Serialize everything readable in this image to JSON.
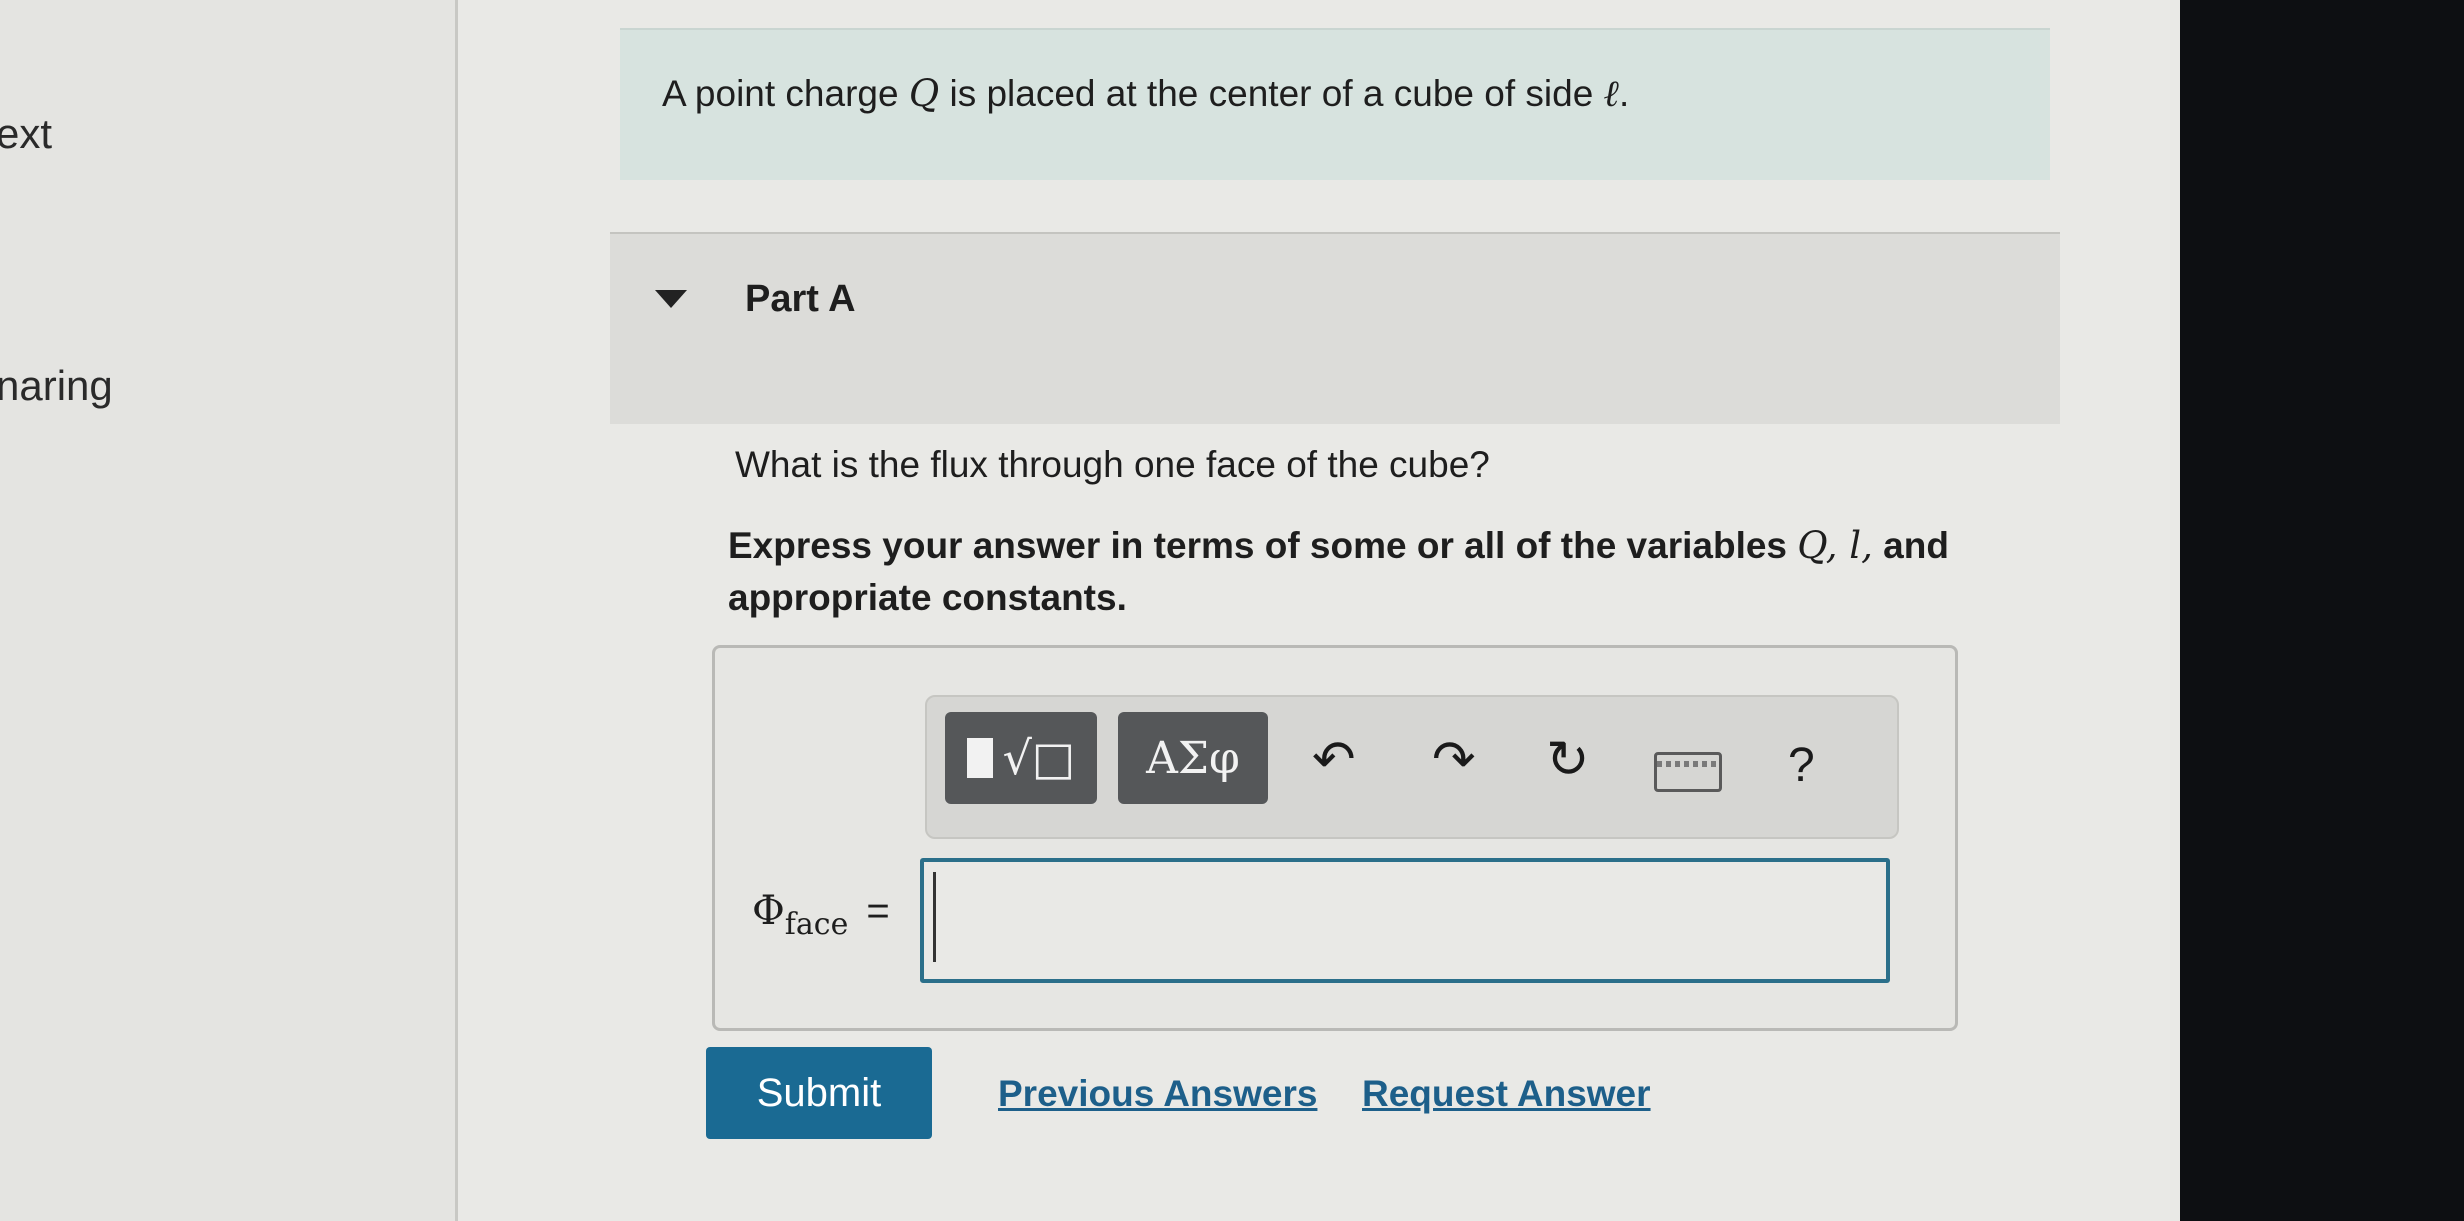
{
  "sidebar": {
    "items": [
      {
        "label": "ext"
      },
      {
        "label": "naring"
      }
    ]
  },
  "problem": {
    "intro_prefix": "A point charge",
    "intro_var": "Q",
    "intro_mid": "is placed at the center of a cube of side",
    "intro_side_var": "ℓ",
    "intro_suffix": "."
  },
  "part": {
    "title": "Part A",
    "question": "What is the flux through one face of the cube?",
    "instruction_prefix": "Express your answer in terms of some or all of the variables",
    "instruction_vars": "Q, l,",
    "instruction_suffix": "and appropriate constants."
  },
  "toolbar": {
    "templates_label": "√□",
    "symbols_label": "ΑΣφ",
    "undo_icon": "↶",
    "redo_icon": "↷",
    "reset_icon": "↻",
    "help_label": "?",
    "icons": [
      "templates-icon",
      "greek-symbols-icon",
      "undo-icon",
      "redo-icon",
      "reset-icon",
      "keyboard-icon",
      "help-icon"
    ]
  },
  "answer": {
    "symbol": "Φ",
    "subscript": "face",
    "equals": "=",
    "value": ""
  },
  "actions": {
    "submit_label": "Submit",
    "previous_answers_label": "Previous Answers",
    "request_answer_label": "Request Answer"
  },
  "colors": {
    "intro_bg": "#d7e3df",
    "submit_bg": "#1a6a93",
    "link": "#1d5f8a",
    "input_border": "#2b6f8a"
  }
}
